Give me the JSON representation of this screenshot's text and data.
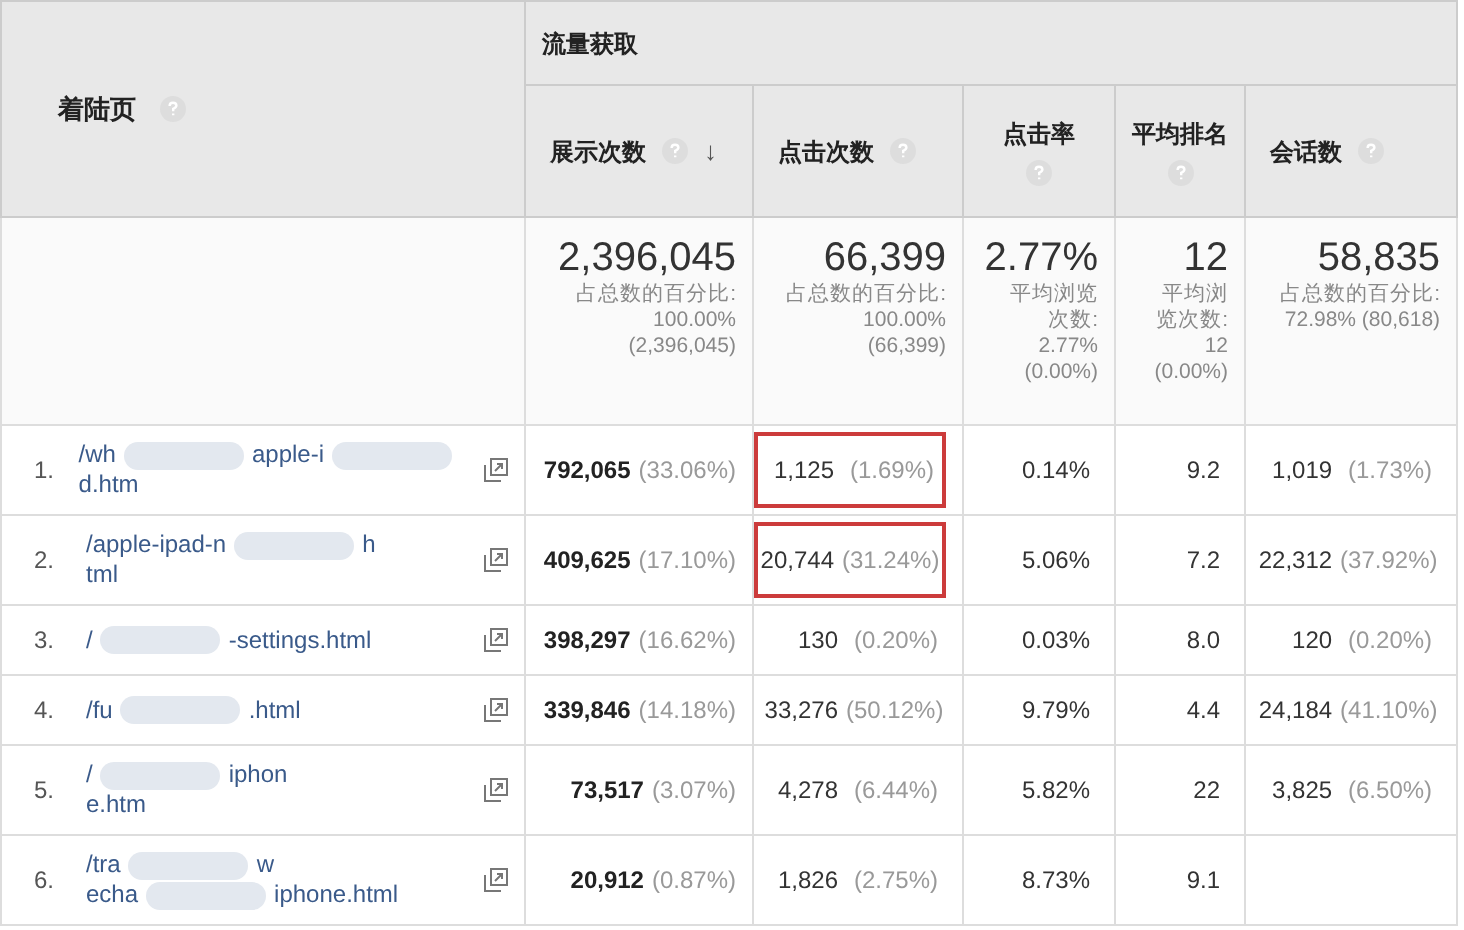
{
  "group_header": "流量获取",
  "landing_header": {
    "label": "着陆页"
  },
  "columns": [
    {
      "label": "展示次数",
      "kind": "inline",
      "sort": "↓"
    },
    {
      "label": "点击次数",
      "kind": "inline"
    },
    {
      "label": "点击率",
      "kind": "stacked"
    },
    {
      "label": "平均排名",
      "kind": "stacked"
    },
    {
      "label": "会话数",
      "kind": "inline"
    }
  ],
  "totals": [
    {
      "value": "2,396,045",
      "note": [
        "占总数的百分比:",
        "100.00%",
        "(2,396,045)"
      ]
    },
    {
      "value": "66,399",
      "note": [
        "占总数的百分比:",
        "100.00%",
        "(66,399)"
      ]
    },
    {
      "value": "2.77%",
      "note": [
        "平均浏览",
        "次数:",
        "2.77%",
        "(0.00%)"
      ]
    },
    {
      "value": "12",
      "note": [
        "平均浏",
        "览次数:",
        "12",
        "(0.00%)"
      ]
    },
    {
      "value": "58,835",
      "note": [
        "占总数的百分比:",
        "72.98% (80,618)"
      ]
    }
  ],
  "rows": [
    {
      "index": "1.",
      "url_lines": [
        [
          {
            "kind": "text",
            "text": "/wh"
          },
          {
            "kind": "redacted"
          },
          {
            "kind": "text",
            "text": "apple-i"
          },
          {
            "kind": "redacted"
          }
        ],
        [
          {
            "kind": "text",
            "text": "d.htm"
          }
        ]
      ],
      "cells": [
        {
          "value": "792,065",
          "pct": "(33.06%)"
        },
        {
          "value": "1,125",
          "pct": "(1.69%)",
          "highlighted": true
        },
        {
          "value": "0.14%"
        },
        {
          "value": "9.2"
        },
        {
          "value": "1,019",
          "pct": "(1.73%)"
        }
      ]
    },
    {
      "index": "2.",
      "url_lines": [
        [
          {
            "kind": "text",
            "text": "/apple-ipad-n"
          },
          {
            "kind": "redacted"
          },
          {
            "kind": "text",
            "text": "h"
          }
        ],
        [
          {
            "kind": "text",
            "text": "tml"
          }
        ]
      ],
      "cells": [
        {
          "value": "409,625",
          "pct": "(17.10%)"
        },
        {
          "value": "20,744",
          "pct": "(31.24%)",
          "highlighted": true
        },
        {
          "value": "5.06%"
        },
        {
          "value": "7.2"
        },
        {
          "value": "22,312",
          "pct": "(37.92%)"
        }
      ]
    },
    {
      "index": "3.",
      "url_lines": [
        [
          {
            "kind": "text",
            "text": "/"
          },
          {
            "kind": "redacted"
          },
          {
            "kind": "text",
            "text": "-settings.html"
          }
        ]
      ],
      "cells": [
        {
          "value": "398,297",
          "pct": "(16.62%)"
        },
        {
          "value": "130",
          "pct": "(0.20%)",
          "highlighted": false
        },
        {
          "value": "0.03%"
        },
        {
          "value": "8.0"
        },
        {
          "value": "120",
          "pct": "(0.20%)"
        }
      ]
    },
    {
      "index": "4.",
      "url_lines": [
        [
          {
            "kind": "text",
            "text": "/fu"
          },
          {
            "kind": "redacted"
          },
          {
            "kind": "text",
            "text": ".html"
          }
        ]
      ],
      "cells": [
        {
          "value": "339,846",
          "pct": "(14.18%)"
        },
        {
          "value": "33,276",
          "pct": "(50.12%)",
          "highlighted": false
        },
        {
          "value": "9.79%"
        },
        {
          "value": "4.4"
        },
        {
          "value": "24,184",
          "pct": "(41.10%)"
        }
      ]
    },
    {
      "index": "5.",
      "url_lines": [
        [
          {
            "kind": "text",
            "text": "/"
          },
          {
            "kind": "redacted"
          },
          {
            "kind": "text",
            "text": "iphon"
          }
        ],
        [
          {
            "kind": "text",
            "text": "e.htm"
          }
        ]
      ],
      "cells": [
        {
          "value": "73,517",
          "pct": "(3.07%)"
        },
        {
          "value": "4,278",
          "pct": "(6.44%)",
          "highlighted": false
        },
        {
          "value": "5.82%"
        },
        {
          "value": "22"
        },
        {
          "value": "3,825",
          "pct": "(6.50%)"
        }
      ]
    },
    {
      "index": "6.",
      "url_lines": [
        [
          {
            "kind": "text",
            "text": "/tra"
          },
          {
            "kind": "redacted"
          },
          {
            "kind": "text",
            "text": "w"
          }
        ],
        [
          {
            "kind": "text",
            "text": "echa"
          },
          {
            "kind": "redacted"
          },
          {
            "kind": "text",
            "text": "iphone.html"
          }
        ]
      ],
      "cells": [
        {
          "value": "20,912",
          "pct": "(0.87%)"
        },
        {
          "value": "1,826",
          "pct": "(2.75%)",
          "highlighted": false
        },
        {
          "value": "8.73%"
        },
        {
          "value": "9.1"
        }
      ]
    }
  ]
}
